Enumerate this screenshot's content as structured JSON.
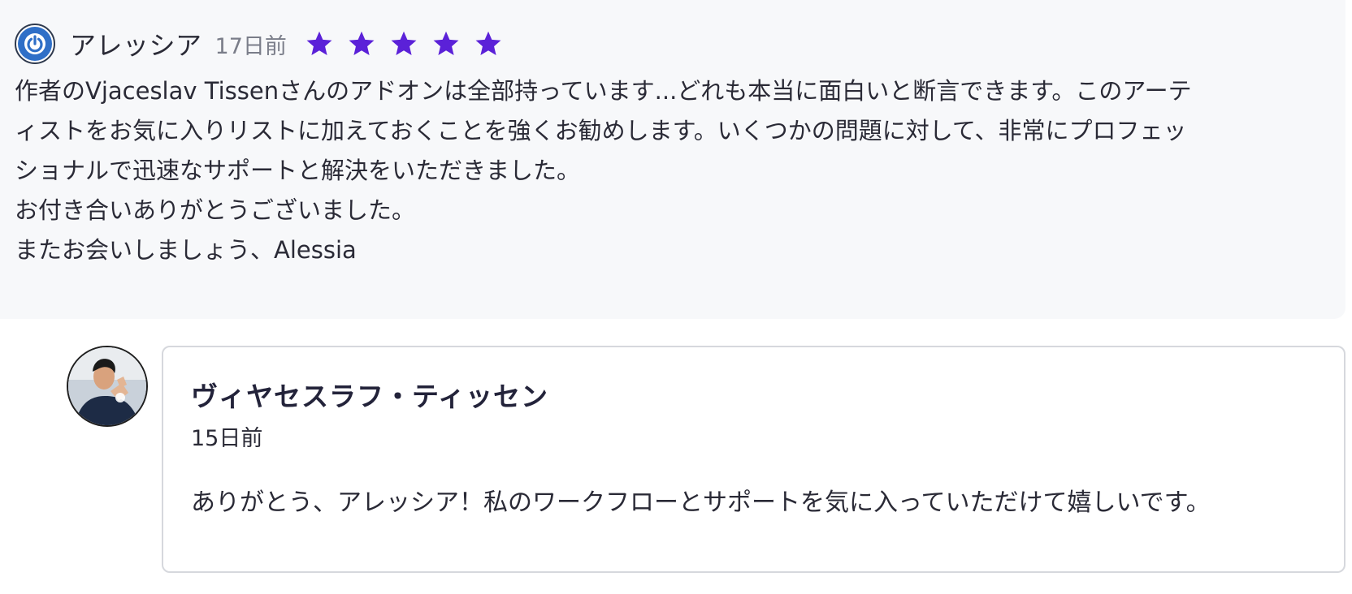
{
  "review": {
    "reviewer_name": "アレッシア",
    "age": "17日前",
    "rating": 5,
    "rating_max": 5,
    "avatar_icon": "power-icon",
    "star_color": "#5b21d8",
    "body_lines": [
      "作者のVjaceslav Tissenさんのアドオンは全部持っています...どれも本当に面白いと断言できます。このアーテ",
      "ィストをお気に入りリストに加えておくことを強くお勧めします。いくつかの問題に対して、非常にプロフェッ",
      "ショナルで迅速なサポートと解決をいただきました。",
      "お付き合いありがとうございました。",
      "またお会いしましょう、Alessia"
    ]
  },
  "reply": {
    "author_name": "ヴィヤセスラフ・ティッセン",
    "age": "15日前",
    "text": "ありがとう、アレッシア！私のワークフローとサポートを気に入っていただけて嬉しいです。"
  }
}
